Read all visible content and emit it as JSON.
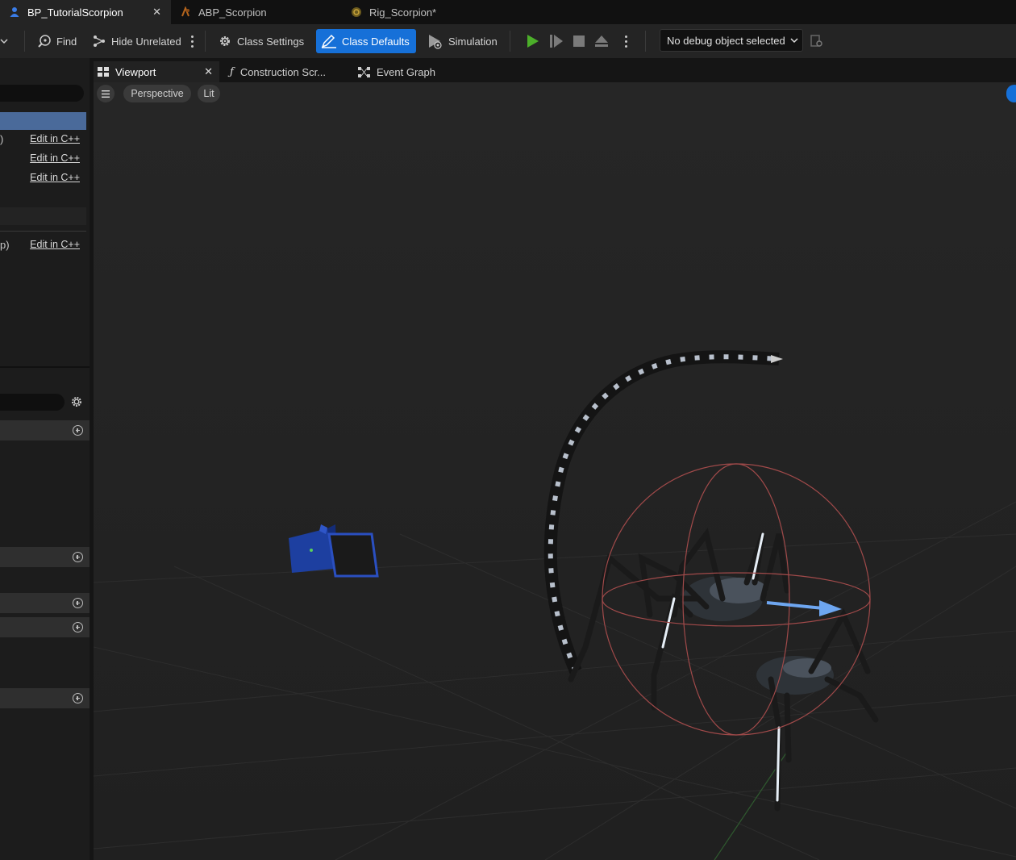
{
  "doc_tabs": [
    {
      "label": "BP_TutorialScorpion",
      "icon": "blueprint-person-icon"
    },
    {
      "label": "ABP_Scorpion",
      "icon": "anim-blueprint-icon"
    },
    {
      "label": "Rig_Scorpion*",
      "icon": "control-rig-icon"
    }
  ],
  "toolbar": {
    "find": "Find",
    "hide_unrelated": "Hide Unrelated",
    "class_settings": "Class Settings",
    "class_defaults": "Class Defaults",
    "simulation": "Simulation",
    "debug_object": "No debug object selected"
  },
  "viewport_tabs": [
    {
      "label": "Viewport",
      "icon": "viewport-grid-icon"
    },
    {
      "label": "Construction Scr...",
      "icon": "function-icon"
    },
    {
      "label": "Event Graph",
      "icon": "event-graph-icon"
    }
  ],
  "left_panel": {
    "rows": [
      {
        "prefix": ")",
        "action": "Edit in C++"
      },
      {
        "prefix": "",
        "action": "Edit in C++"
      },
      {
        "prefix": "",
        "action": "Edit in C++"
      },
      {
        "prefix": "p)",
        "action": "Edit in C++"
      }
    ]
  },
  "viewport": {
    "view_mode": "Perspective",
    "lighting": "Lit"
  },
  "colors": {
    "accent": "#1670d8",
    "play": "#4caf2a",
    "selection": "#4a6a9a"
  }
}
